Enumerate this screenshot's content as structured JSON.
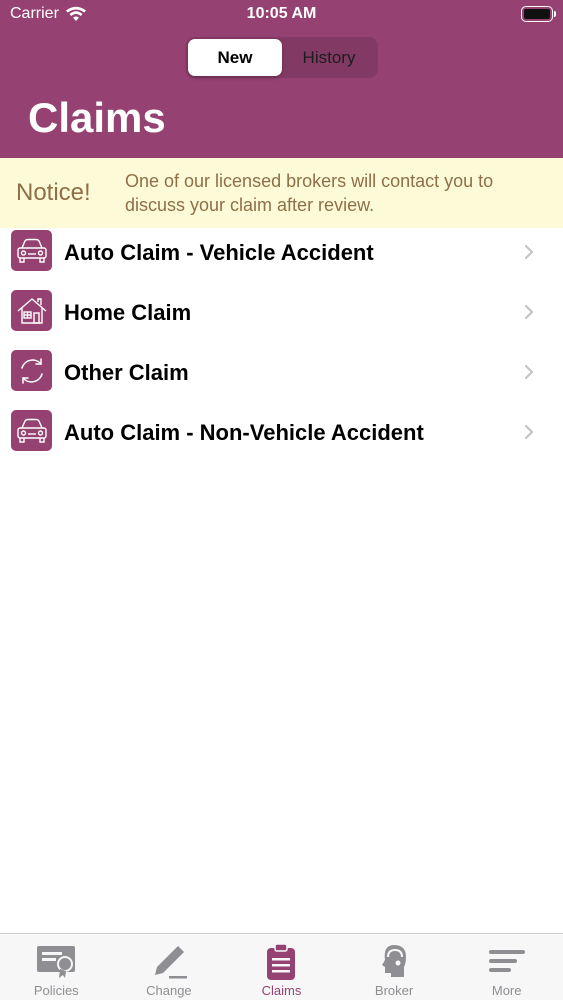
{
  "status_bar": {
    "carrier": "Carrier",
    "time": "10:05 AM"
  },
  "segments": [
    {
      "label": "New",
      "active": true
    },
    {
      "label": "History",
      "active": false
    }
  ],
  "page_title": "Claims",
  "notice": {
    "label": "Notice!",
    "text": "One of our licensed brokers will contact you to discuss your claim after review."
  },
  "claims": [
    {
      "label": "Auto Claim - Vehicle Accident",
      "icon": "car-icon"
    },
    {
      "label": "Home Claim",
      "icon": "house-icon"
    },
    {
      "label": "Other Claim",
      "icon": "refresh-icon"
    },
    {
      "label": "Auto Claim - Non-Vehicle Accident",
      "icon": "car-icon"
    }
  ],
  "tabs": [
    {
      "label": "Policies",
      "icon": "certificate-icon",
      "active": false
    },
    {
      "label": "Change",
      "icon": "pencil-icon",
      "active": false
    },
    {
      "label": "Claims",
      "icon": "clipboard-icon",
      "active": true
    },
    {
      "label": "Broker",
      "icon": "headset-person-icon",
      "active": false
    },
    {
      "label": "More",
      "icon": "menu-lines-icon",
      "active": false
    }
  ],
  "colors": {
    "brand": "#954272",
    "notice_bg": "#fdfbd7",
    "notice_text": "#8e6f47",
    "tab_inactive": "#8e8e93"
  }
}
